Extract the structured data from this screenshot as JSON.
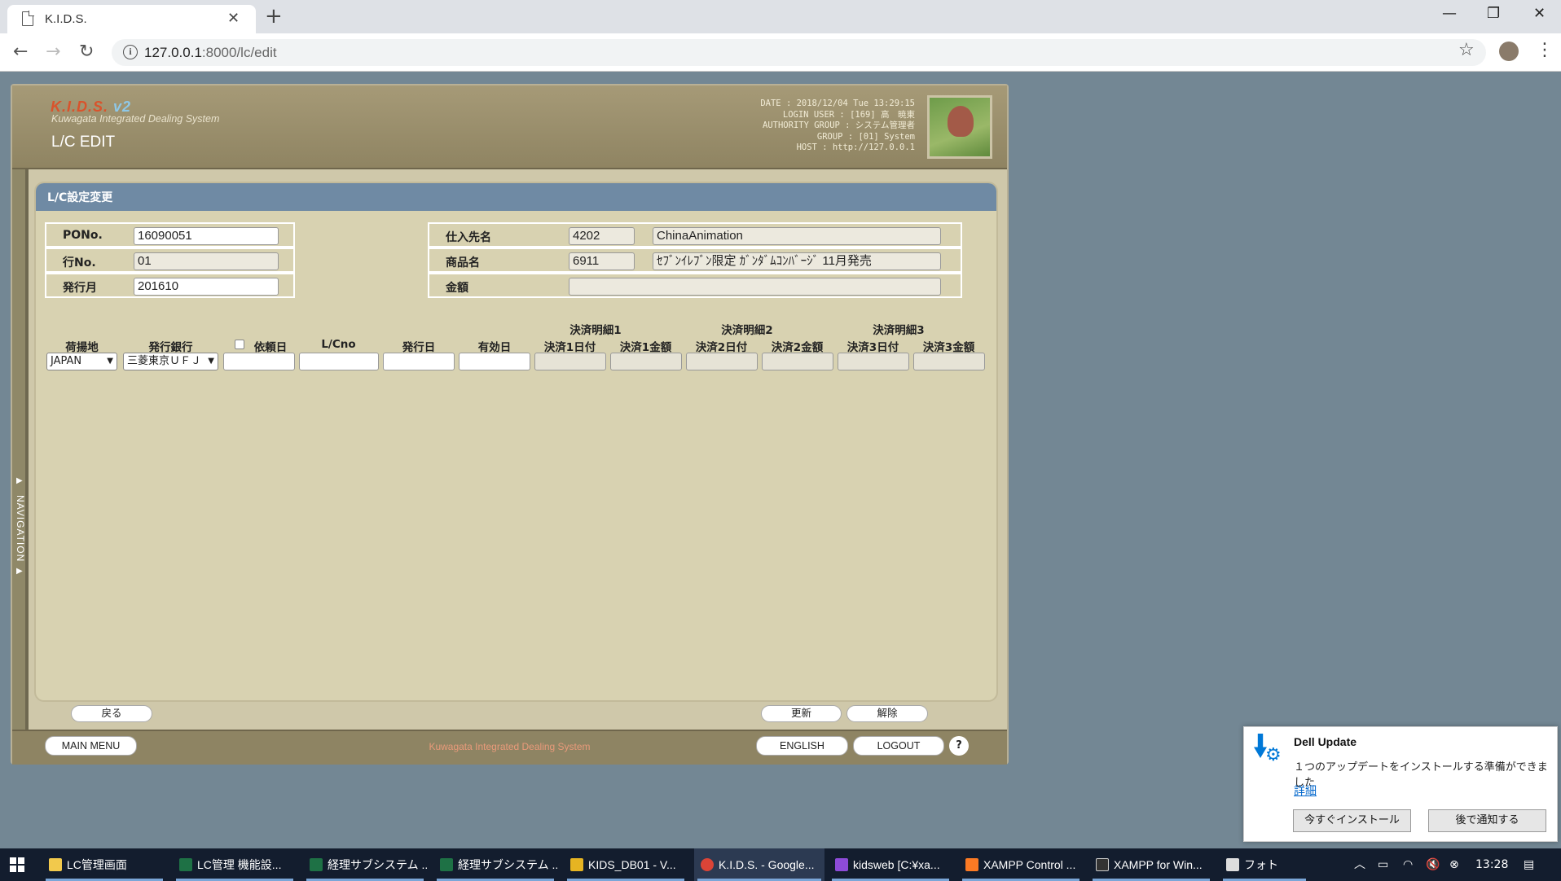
{
  "browser": {
    "tab_title": "K.I.D.S.",
    "url_host": "127.0.0.1",
    "url_path": ":8000/lc/edit"
  },
  "header": {
    "logo": "K.I.D.S.",
    "logo_version": "v2",
    "logo_subtitle": "Kuwagata Integrated Dealing System",
    "screen_title": "L/C EDIT",
    "info_lines": [
      "DATE : 2018/12/04 Tue 13:29:15",
      "LOGIN USER : [169] 高　暁東",
      "AUTHORITY GROUP : システム管理者",
      "GROUP : [01] System",
      "HOST : http://127.0.0.1"
    ]
  },
  "side_nav": {
    "label": "NAVIGATION"
  },
  "panel": {
    "title": "L/C設定変更",
    "fields": {
      "po_label": "PONo.",
      "po_value": "16090051",
      "line_label": "行No.",
      "line_value": "01",
      "issue_month_label": "発行月",
      "issue_month_value": "201610",
      "supplier_label": "仕入先名",
      "supplier_code": "4202",
      "supplier_name": "ChinaAnimation",
      "product_label": "商品名",
      "product_code": "6911",
      "product_name": "ｾﾌﾞﾝｲﾚﾌﾞﾝ限定 ｶﾞﾝﾀﾞﾑｺﾝﾊﾞｰｼﾞ 11月発売",
      "amount_label": "金額",
      "amount_value": ""
    },
    "groups": [
      "決済明細1",
      "決済明細2",
      "決済明細3"
    ],
    "columns": [
      "荷揚地",
      "発行銀行",
      "依頼日",
      "L/Cno",
      "発行日",
      "有効日",
      "決済1日付",
      "決済1金額",
      "決済2日付",
      "決済2金額",
      "決済3日付",
      "決済3金額"
    ],
    "row": {
      "port": "JAPAN",
      "bank": "三菱東京ＵＦＪ"
    }
  },
  "buttons": {
    "back": "戻る",
    "update": "更新",
    "release": "解除",
    "main_menu": "MAIN MENU",
    "english": "ENGLISH",
    "logout": "LOGOUT",
    "help": "?"
  },
  "footer": {
    "text": "Kuwagata Integrated Dealing System"
  },
  "toast": {
    "title": "Dell Update",
    "body": "１つのアップデートをインストールする準備ができました",
    "link": "詳細",
    "install": "今すぐインストール",
    "later": "後で通知する"
  },
  "taskbar": {
    "items": [
      "LC管理画面",
      "LC管理 機能設...",
      "経理サブシステム ...",
      "経理サブシステム ...",
      "KIDS_DB01 - V...",
      "K.I.D.S. - Google...",
      "kidsweb [C:¥xa...",
      "XAMPP Control ...",
      "XAMPP for Win...",
      "フォト"
    ],
    "time": "13:28"
  },
  "colors": {
    "header": "#8f8462",
    "panel": "#d8d2b1",
    "panel_head": "#6f8aa4",
    "page_bg": "#738794",
    "accent_link": "#0066cc"
  }
}
